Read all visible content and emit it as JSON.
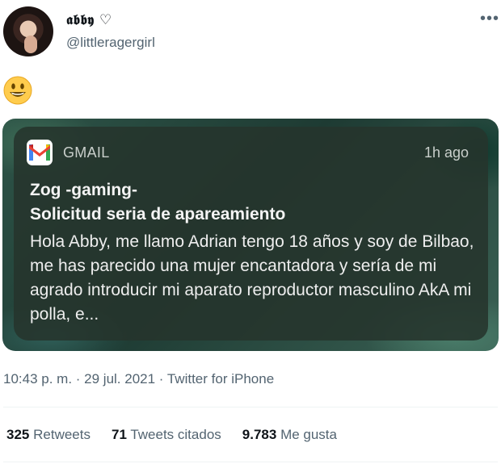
{
  "tweet": {
    "display_name": "𝖆𝖇𝖇𝖞 ♡",
    "handle": "@littleragergirl",
    "emoji": "😀",
    "timestamp": "10:43 p. m. · 29 jul. 2021 · Twitter for iPhone"
  },
  "notification": {
    "app": "GMAIL",
    "time": "1h ago",
    "sender": "Zog -gaming-",
    "subject": "Solicitud seria de apareamiento",
    "body": "Hola Abby, me llamo Adrian tengo 18 años y soy de Bilbao, me has parecido una mujer encantadora y sería de mi agrado introducir mi aparato reproductor masculino AkA mi polla, e..."
  },
  "stats": {
    "retweets_count": "325",
    "retweets_label": "Retweets",
    "quotes_count": "71",
    "quotes_label": "Tweets citados",
    "likes_count": "9.783",
    "likes_label": "Me gusta"
  },
  "icons": {
    "more": "more-horizontal-icon",
    "gmail": "gmail-icon"
  },
  "colors": {
    "secondary_text": "#536471",
    "primary_text": "#0f1419"
  }
}
